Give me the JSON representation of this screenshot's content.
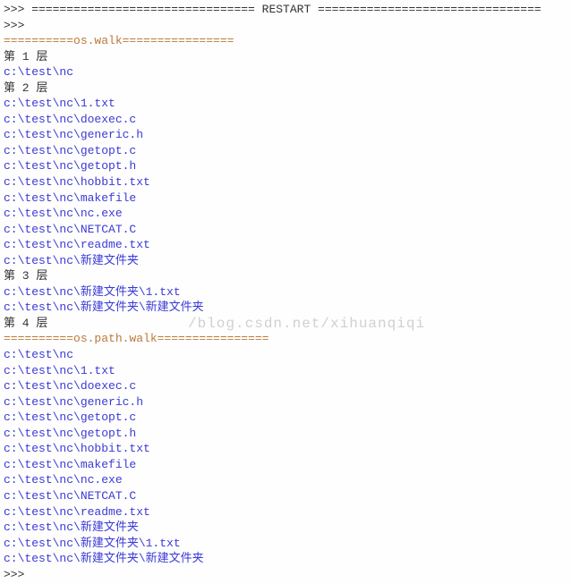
{
  "header": {
    "prompt": ">>>",
    "restart_line": ">>> ================================ RESTART ================================",
    "prompt2": ">>>"
  },
  "section1": {
    "title": "==========os.walk================",
    "layers": [
      {
        "label": "第 1 层",
        "files": [
          "c:\\test\\nc"
        ]
      },
      {
        "label": "第 2 层",
        "files": [
          "c:\\test\\nc\\1.txt",
          "c:\\test\\nc\\doexec.c",
          "c:\\test\\nc\\generic.h",
          "c:\\test\\nc\\getopt.c",
          "c:\\test\\nc\\getopt.h",
          "c:\\test\\nc\\hobbit.txt",
          "c:\\test\\nc\\makefile",
          "c:\\test\\nc\\nc.exe",
          "c:\\test\\nc\\NETCAT.C",
          "c:\\test\\nc\\readme.txt",
          "c:\\test\\nc\\新建文件夹"
        ]
      },
      {
        "label": "第 3 层",
        "files": [
          "c:\\test\\nc\\新建文件夹\\1.txt",
          "c:\\test\\nc\\新建文件夹\\新建文件夹"
        ]
      },
      {
        "label": "第 4 层",
        "files": []
      }
    ]
  },
  "section2": {
    "title": "==========os.path.walk================",
    "files": [
      "c:\\test\\nc",
      "c:\\test\\nc\\1.txt",
      "c:\\test\\nc\\doexec.c",
      "c:\\test\\nc\\generic.h",
      "c:\\test\\nc\\getopt.c",
      "c:\\test\\nc\\getopt.h",
      "c:\\test\\nc\\hobbit.txt",
      "c:\\test\\nc\\makefile",
      "c:\\test\\nc\\nc.exe",
      "c:\\test\\nc\\NETCAT.C",
      "c:\\test\\nc\\readme.txt",
      "c:\\test\\nc\\新建文件夹",
      "c:\\test\\nc\\新建文件夹\\1.txt",
      "c:\\test\\nc\\新建文件夹\\新建文件夹"
    ]
  },
  "footer": {
    "prompt": ">>>"
  },
  "watermark": "/blog.csdn.net/xihuanqiqi"
}
